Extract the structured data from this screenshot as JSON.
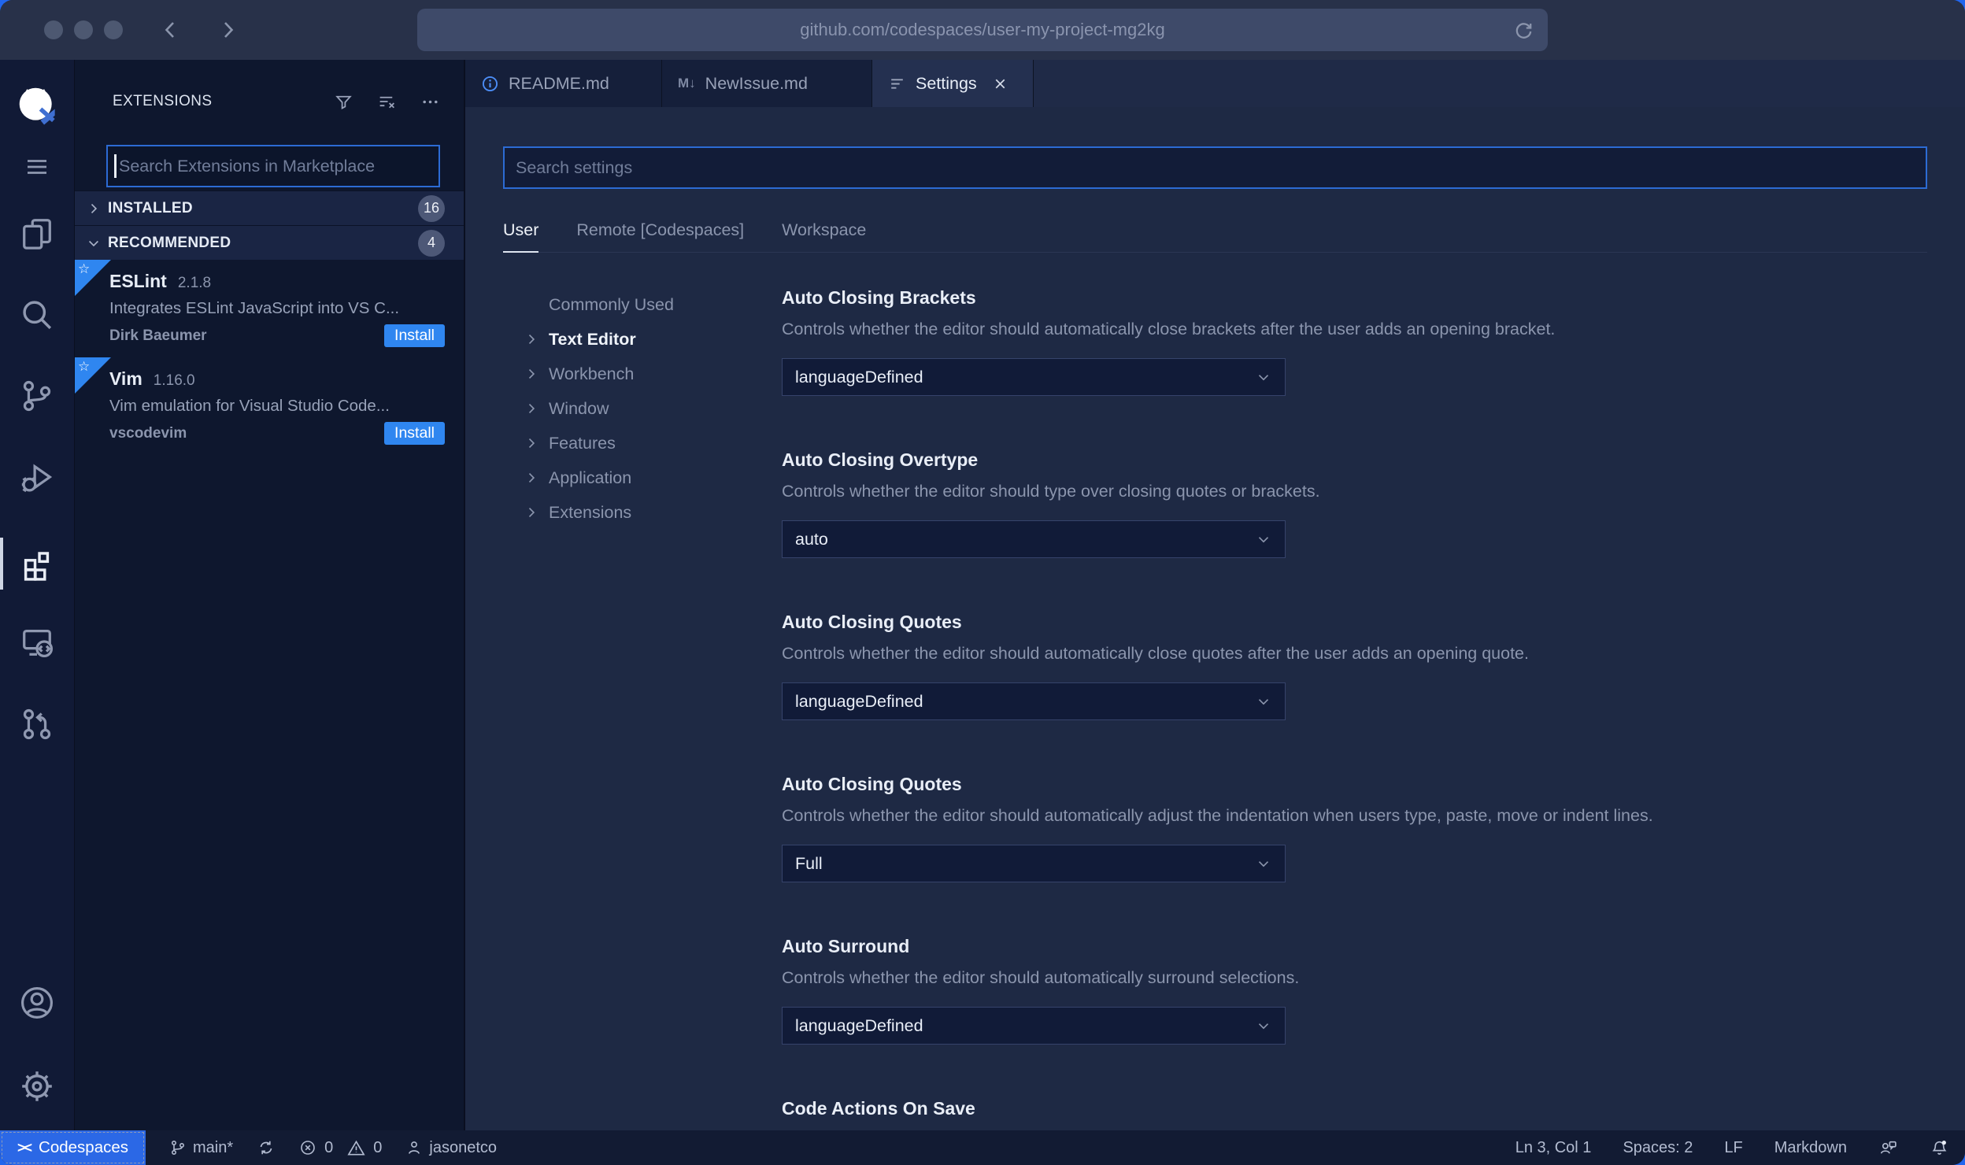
{
  "browser": {
    "url": "github.com/codespaces/user-my-project-mg2kg"
  },
  "activity_bar": {
    "top": [
      {
        "icon": "github-codespaces-logo"
      },
      {
        "icon": "menu"
      },
      {
        "icon": "explorer"
      },
      {
        "icon": "search"
      },
      {
        "icon": "source-control"
      },
      {
        "icon": "run-debug"
      },
      {
        "icon": "extensions",
        "active": true
      },
      {
        "icon": "remote-explorer"
      },
      {
        "icon": "pull-request"
      }
    ],
    "bottom": [
      {
        "icon": "account"
      },
      {
        "icon": "settings-gear"
      }
    ]
  },
  "sidebar": {
    "title": "EXTENSIONS",
    "search": {
      "placeholder": "Search Extensions in Marketplace"
    },
    "sections": [
      {
        "label": "INSTALLED",
        "count": "16"
      },
      {
        "label": "RECOMMENDED",
        "count": "4"
      }
    ],
    "extensions": [
      {
        "name": "ESLint",
        "version": "2.1.8",
        "description": "Integrates ESLint JavaScript into VS C...",
        "author": "Dirk Baeumer",
        "action": "Install"
      },
      {
        "name": "Vim",
        "version": "1.16.0",
        "description": "Vim emulation for Visual Studio Code...",
        "author": "vscodevim",
        "action": "Install"
      }
    ]
  },
  "editor_tabs": [
    {
      "label": "README.md",
      "icon": "info"
    },
    {
      "label": "NewIssue.md",
      "icon": "markdown"
    },
    {
      "label": "Settings",
      "icon": "settings-list",
      "active": true,
      "closable": true
    }
  ],
  "settings_page": {
    "search": {
      "placeholder": "Search settings"
    },
    "scopes": [
      {
        "label": "User",
        "active": true
      },
      {
        "label": "Remote [Codespaces]"
      },
      {
        "label": "Workspace"
      }
    ],
    "toc": [
      {
        "label": "Commonly Used"
      },
      {
        "label": "Text Editor",
        "active": true
      },
      {
        "label": "Workbench"
      },
      {
        "label": "Window"
      },
      {
        "label": "Features"
      },
      {
        "label": "Application"
      },
      {
        "label": "Extensions"
      }
    ],
    "items": [
      {
        "title": "Auto Closing Brackets",
        "description": "Controls whether the editor should automatically close brackets after the user adds an opening bracket.",
        "value": "languageDefined"
      },
      {
        "title": "Auto Closing Overtype",
        "description": "Controls whether the editor should type over closing quotes or brackets.",
        "value": "auto"
      },
      {
        "title": "Auto Closing Quotes",
        "description": "Controls whether the editor should automatically close quotes after the user adds an opening quote.",
        "value": "languageDefined"
      },
      {
        "title": "Auto Closing Quotes",
        "description": "Controls whether the editor should automatically adjust the indentation when users type, paste, move or indent lines.",
        "value": "Full"
      },
      {
        "title": "Auto Surround",
        "description": "Controls whether the editor should automatically surround selections.",
        "value": "languageDefined"
      },
      {
        "title": "Code Actions On Save"
      }
    ]
  },
  "status_bar": {
    "remote": {
      "label": "Codespaces"
    },
    "branch": {
      "label": "main*"
    },
    "problems": {
      "errors": "0",
      "warnings": "0"
    },
    "user": {
      "label": "jasonetco"
    },
    "right": {
      "cursor": "Ln 3, Col 1",
      "indentation": "Spaces: 2",
      "eol": "LF",
      "language": "Markdown"
    }
  },
  "colors": {
    "accent_blue": "#2f86f0",
    "focus_border": "#2c6bd4",
    "statusbar_remote_bg": "#2b68e6",
    "tab_active_bg": "#243050",
    "editor_bg": "#1e2944",
    "sidebar_bg": "#0e172e",
    "activity_bar_bg": "#111a36",
    "chrome_bg": "#283149"
  }
}
